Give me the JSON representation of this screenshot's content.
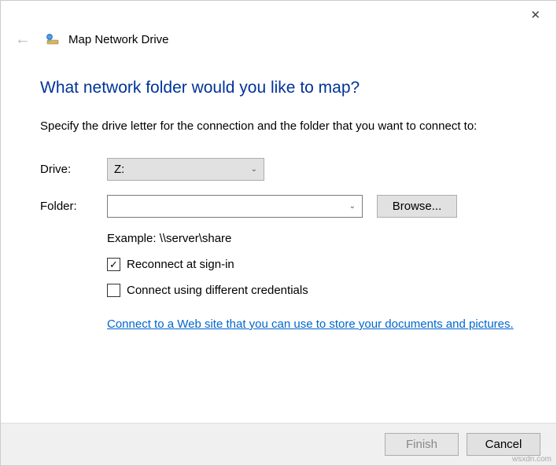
{
  "header": {
    "title": "Map Network Drive"
  },
  "main": {
    "heading": "What network folder would you like to map?",
    "instruction": "Specify the drive letter for the connection and the folder that you want to connect to:",
    "drive_label": "Drive:",
    "drive_value": "Z:",
    "folder_label": "Folder:",
    "folder_value": "",
    "browse_label": "Browse...",
    "example": "Example: \\\\server\\share",
    "reconnect_label": "Reconnect at sign-in",
    "reconnect_checked": true,
    "different_creds_label": "Connect using different credentials",
    "different_creds_checked": false,
    "link_text": "Connect to a Web site that you can use to store your documents and pictures."
  },
  "footer": {
    "finish": "Finish",
    "cancel": "Cancel"
  },
  "watermark": "wsxdn.com"
}
